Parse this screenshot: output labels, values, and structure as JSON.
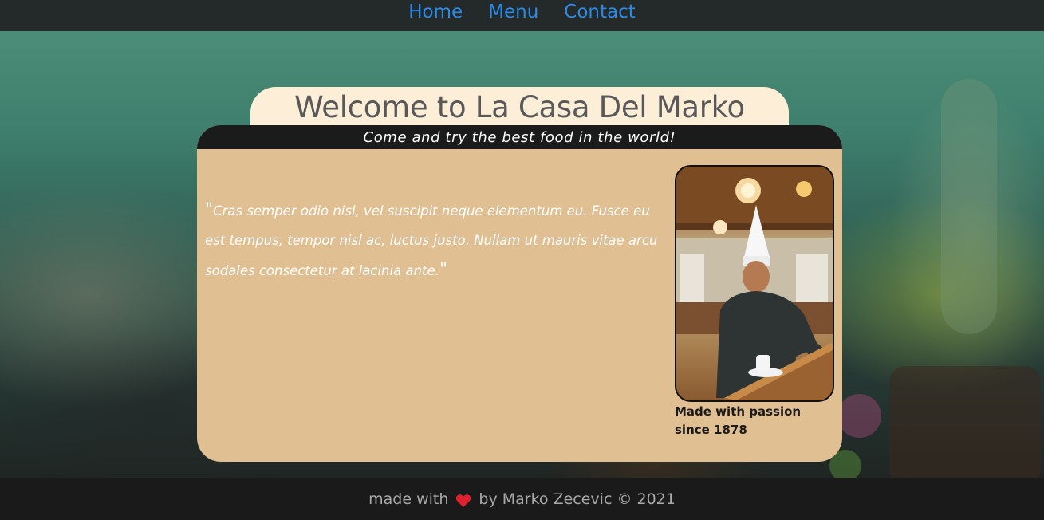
{
  "nav": {
    "items": [
      {
        "label": "Home"
      },
      {
        "label": "Menu"
      },
      {
        "label": "Contact"
      }
    ],
    "link_color": "#2b8be6"
  },
  "hero": {
    "title": "Welcome to La Casa Del Marko",
    "tagline": "Come and try the best food in the world!",
    "quote_open": "\"",
    "quote_text": "Cras semper odio nisl, vel suscipit neque elementum eu. Fusce eu est tempus, tempor nisl ac, luctus justo. Nullam ut mauris vitae arcu sodales consectetur at lacinia ante.",
    "quote_close": "\"",
    "photo_caption": "Made with passion since 1878"
  },
  "footer": {
    "text_before": "made with",
    "heart_icon": "heart-icon",
    "text_after": "by Marko Zecevic © 2021"
  },
  "colors": {
    "card_background": "#e0bf92",
    "title_tab": "#fdefd7",
    "header_bar": "#1b1b1b",
    "footer_background": "#1a1a1a"
  }
}
